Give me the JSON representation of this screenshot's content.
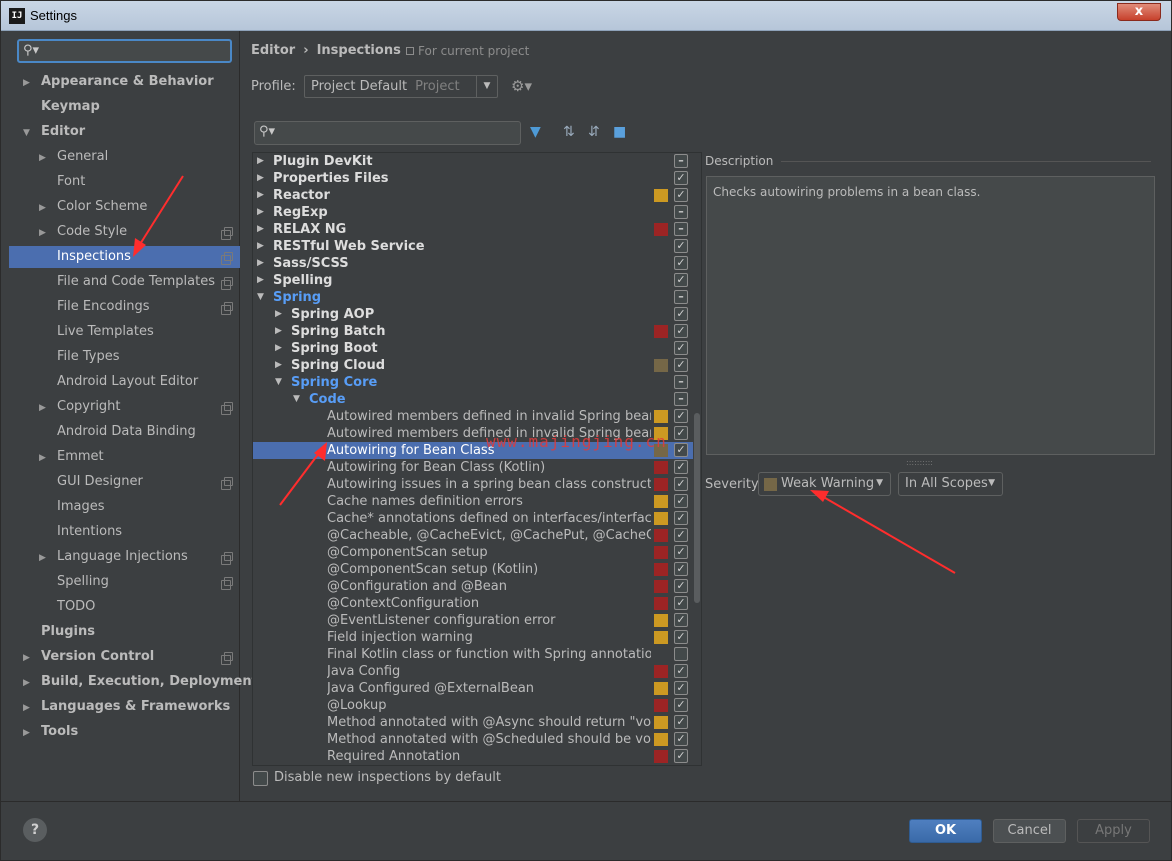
{
  "window": {
    "title": "Settings",
    "app_icon": "IJ",
    "close_label": "x",
    "ghost_title": ""
  },
  "sidebar": {
    "items": [
      {
        "label": "Appearance & Behavior",
        "bold": true,
        "arrow": "right",
        "indent": 0
      },
      {
        "label": "Keymap",
        "bold": true,
        "arrow": "",
        "indent": 0
      },
      {
        "label": "Editor",
        "bold": true,
        "arrow": "down",
        "indent": 0
      },
      {
        "label": "General",
        "bold": false,
        "arrow": "right",
        "indent": 1
      },
      {
        "label": "Font",
        "bold": false,
        "arrow": "",
        "indent": 1
      },
      {
        "label": "Color Scheme",
        "bold": false,
        "arrow": "right",
        "indent": 1
      },
      {
        "label": "Code Style",
        "bold": false,
        "arrow": "right",
        "indent": 1,
        "copy": true
      },
      {
        "label": "Inspections",
        "bold": false,
        "arrow": "",
        "indent": 1,
        "copy": true,
        "selected": true
      },
      {
        "label": "File and Code Templates",
        "bold": false,
        "arrow": "",
        "indent": 1,
        "copy": true
      },
      {
        "label": "File Encodings",
        "bold": false,
        "arrow": "",
        "indent": 1,
        "copy": true
      },
      {
        "label": "Live Templates",
        "bold": false,
        "arrow": "",
        "indent": 1
      },
      {
        "label": "File Types",
        "bold": false,
        "arrow": "",
        "indent": 1
      },
      {
        "label": "Android Layout Editor",
        "bold": false,
        "arrow": "",
        "indent": 1
      },
      {
        "label": "Copyright",
        "bold": false,
        "arrow": "right",
        "indent": 1,
        "copy": true
      },
      {
        "label": "Android Data Binding",
        "bold": false,
        "arrow": "",
        "indent": 1
      },
      {
        "label": "Emmet",
        "bold": false,
        "arrow": "right",
        "indent": 1
      },
      {
        "label": "GUI Designer",
        "bold": false,
        "arrow": "",
        "indent": 1,
        "copy": true
      },
      {
        "label": "Images",
        "bold": false,
        "arrow": "",
        "indent": 1
      },
      {
        "label": "Intentions",
        "bold": false,
        "arrow": "",
        "indent": 1
      },
      {
        "label": "Language Injections",
        "bold": false,
        "arrow": "right",
        "indent": 1,
        "copy": true
      },
      {
        "label": "Spelling",
        "bold": false,
        "arrow": "",
        "indent": 1,
        "copy": true
      },
      {
        "label": "TODO",
        "bold": false,
        "arrow": "",
        "indent": 1
      },
      {
        "label": "Plugins",
        "bold": true,
        "arrow": "",
        "indent": 0
      },
      {
        "label": "Version Control",
        "bold": true,
        "arrow": "right",
        "indent": 0,
        "copy": true
      },
      {
        "label": "Build, Execution, Deployment",
        "bold": true,
        "arrow": "right",
        "indent": 0
      },
      {
        "label": "Languages & Frameworks",
        "bold": true,
        "arrow": "right",
        "indent": 0
      },
      {
        "label": "Tools",
        "bold": true,
        "arrow": "right",
        "indent": 0
      }
    ]
  },
  "header": {
    "breadcrumb_1": "Editor",
    "breadcrumb_sep": "›",
    "breadcrumb_2": "Inspections",
    "scope_note": "For current project"
  },
  "profile": {
    "label": "Profile:",
    "value": "Project Default",
    "sub": "Project",
    "dropdown": "▼"
  },
  "inspections": {
    "rows": [
      {
        "label": "Plugin DevKit",
        "level": 0,
        "arrow": "right",
        "type": "group",
        "sev": "",
        "check": "minus"
      },
      {
        "label": "Properties Files",
        "level": 0,
        "arrow": "right",
        "type": "group",
        "sev": "",
        "check": "check"
      },
      {
        "label": "Reactor",
        "level": 0,
        "arrow": "right",
        "type": "group",
        "sev": "#cc9922",
        "check": "check"
      },
      {
        "label": "RegExp",
        "level": 0,
        "arrow": "right",
        "type": "group",
        "sev": "",
        "check": "minus"
      },
      {
        "label": "RELAX NG",
        "level": 0,
        "arrow": "right",
        "type": "group",
        "sev": "#9c2424",
        "check": "minus"
      },
      {
        "label": "RESTful Web Service",
        "level": 0,
        "arrow": "right",
        "type": "group",
        "sev": "",
        "check": "check"
      },
      {
        "label": "Sass/SCSS",
        "level": 0,
        "arrow": "right",
        "type": "group",
        "sev": "",
        "check": "check"
      },
      {
        "label": "Spelling",
        "level": 0,
        "arrow": "right",
        "type": "group",
        "sev": "",
        "check": "check"
      },
      {
        "label": "Spring",
        "level": 0,
        "arrow": "down",
        "type": "blue",
        "sev": "",
        "check": "minus"
      },
      {
        "label": "Spring AOP",
        "level": 1,
        "arrow": "right",
        "type": "group",
        "sev": "",
        "check": "check"
      },
      {
        "label": "Spring Batch",
        "level": 1,
        "arrow": "right",
        "type": "group",
        "sev": "#9c2424",
        "check": "check"
      },
      {
        "label": "Spring Boot",
        "level": 1,
        "arrow": "right",
        "type": "group",
        "sev": "",
        "check": "check"
      },
      {
        "label": "Spring Cloud",
        "level": 1,
        "arrow": "right",
        "type": "group",
        "sev": "#756747",
        "check": "check"
      },
      {
        "label": "Spring Core",
        "level": 1,
        "arrow": "down",
        "type": "blue",
        "sev": "",
        "check": "minus"
      },
      {
        "label": "Code",
        "level": 2,
        "arrow": "down",
        "type": "blue",
        "sev": "",
        "check": "minus"
      },
      {
        "label": "Autowired members defined in invalid Spring bean",
        "level": 3,
        "arrow": "",
        "type": "leaf",
        "sev": "#cc9922",
        "check": "check"
      },
      {
        "label": "Autowired members defined in invalid Spring bean (Kotlin)",
        "level": 3,
        "arrow": "",
        "type": "leaf",
        "sev": "#cc9922",
        "check": "check"
      },
      {
        "label": "Autowiring for Bean Class",
        "level": 3,
        "arrow": "",
        "type": "leaf",
        "sev": "#756747",
        "check": "check",
        "selected": true
      },
      {
        "label": "Autowiring for Bean Class (Kotlin)",
        "level": 3,
        "arrow": "",
        "type": "leaf",
        "sev": "#9c2424",
        "check": "check"
      },
      {
        "label": "Autowiring issues in a spring bean class constructors",
        "level": 3,
        "arrow": "",
        "type": "leaf",
        "sev": "#9c2424",
        "check": "check"
      },
      {
        "label": "Cache names definition errors",
        "level": 3,
        "arrow": "",
        "type": "leaf",
        "sev": "#cc9922",
        "check": "check"
      },
      {
        "label": "Cache* annotations defined on interfaces/interface methods",
        "level": 3,
        "arrow": "",
        "type": "leaf",
        "sev": "#cc9922",
        "check": "check"
      },
      {
        "label": "@Cacheable, @CacheEvict, @CachePut, @CacheConfig errors",
        "level": 3,
        "arrow": "",
        "type": "leaf",
        "sev": "#9c2424",
        "check": "check"
      },
      {
        "label": "@ComponentScan setup",
        "level": 3,
        "arrow": "",
        "type": "leaf",
        "sev": "#9c2424",
        "check": "check"
      },
      {
        "label": "@ComponentScan setup (Kotlin)",
        "level": 3,
        "arrow": "",
        "type": "leaf",
        "sev": "#9c2424",
        "check": "check"
      },
      {
        "label": "@Configuration and @Bean",
        "level": 3,
        "arrow": "",
        "type": "leaf",
        "sev": "#9c2424",
        "check": "check"
      },
      {
        "label": "@ContextConfiguration",
        "level": 3,
        "arrow": "",
        "type": "leaf",
        "sev": "#9c2424",
        "check": "check"
      },
      {
        "label": "@EventListener configuration error",
        "level": 3,
        "arrow": "",
        "type": "leaf",
        "sev": "#cc9922",
        "check": "check"
      },
      {
        "label": "Field injection warning",
        "level": 3,
        "arrow": "",
        "type": "leaf",
        "sev": "#cc9922",
        "check": "check"
      },
      {
        "label": "Final Kotlin class or function with Spring annotation",
        "level": 3,
        "arrow": "",
        "type": "leaf",
        "sev": "",
        "check": "empty"
      },
      {
        "label": "Java Config",
        "level": 3,
        "arrow": "",
        "type": "leaf",
        "sev": "#9c2424",
        "check": "check"
      },
      {
        "label": "Java Configured @ExternalBean",
        "level": 3,
        "arrow": "",
        "type": "leaf",
        "sev": "#cc9922",
        "check": "check"
      },
      {
        "label": "@Lookup",
        "level": 3,
        "arrow": "",
        "type": "leaf",
        "sev": "#9c2424",
        "check": "check"
      },
      {
        "label": "Method annotated with @Async should return \"void\" or \"Future\"",
        "level": 3,
        "arrow": "",
        "type": "leaf",
        "sev": "#cc9922",
        "check": "check"
      },
      {
        "label": "Method annotated with @Scheduled should be void and have no parameters",
        "level": 3,
        "arrow": "",
        "type": "leaf",
        "sev": "#cc9922",
        "check": "check"
      },
      {
        "label": "Required Annotation",
        "level": 3,
        "arrow": "",
        "type": "leaf",
        "sev": "#9c2424",
        "check": "check"
      }
    ],
    "disable_label": "Disable new inspections by default"
  },
  "description": {
    "title": "Description",
    "text": "Checks autowiring problems in a bean class."
  },
  "severity": {
    "label": "Severity:",
    "value": "Weak Warning",
    "swatch": "#756747",
    "scope": "In All Scopes"
  },
  "footer": {
    "help": "?",
    "ok": "OK",
    "cancel": "Cancel",
    "apply": "Apply"
  },
  "annotation": {
    "watermark": "www.majingjing.cn"
  },
  "colors": {
    "accent": "#4b6eaf",
    "error": "#9c2424",
    "warning": "#cc9922",
    "weak_warning": "#756747",
    "arrow": "#ff2d2d"
  }
}
